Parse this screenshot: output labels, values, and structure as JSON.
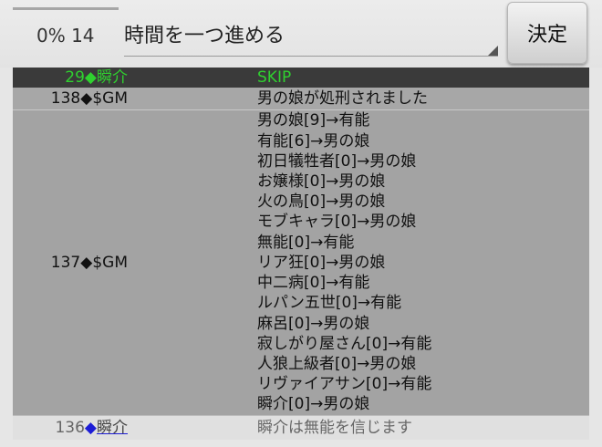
{
  "header": {
    "progress_text": "0% 14",
    "progress_value": 0,
    "action_value": "時間を一つ進める",
    "decide_label": "決定"
  },
  "log": [
    {
      "day": "29",
      "name": "瞬介",
      "message": "SKIP"
    },
    {
      "day": "138",
      "name": "$GM",
      "message": "男の娘が処刑されました"
    },
    {
      "day": "137",
      "name": "$GM",
      "lines": [
        "男の娘[9]→有能",
        "有能[6]→男の娘",
        "初日犠牲者[0]→男の娘",
        "お嬢様[0]→男の娘",
        "火の鳥[0]→男の娘",
        "モブキャラ[0]→男の娘",
        "無能[0]→有能",
        "リア狂[0]→男の娘",
        "中二病[0]→有能",
        "ルパン五世[0]→有能",
        "麻呂[0]→男の娘",
        "寂しがり屋さん[0]→有能",
        "人狼上級者[0]→男の娘",
        "リヴァイアサン[0]→有能",
        "瞬介[0]→男の娘"
      ]
    },
    {
      "day": "136",
      "name": "瞬介",
      "message": "瞬介は無能を信じます"
    }
  ],
  "diamond": "◆",
  "colors": {
    "skip_text": "#2fd12f",
    "diamond_blue": "#1c1cd6",
    "skip_row_bg": "#3a3a3a"
  }
}
